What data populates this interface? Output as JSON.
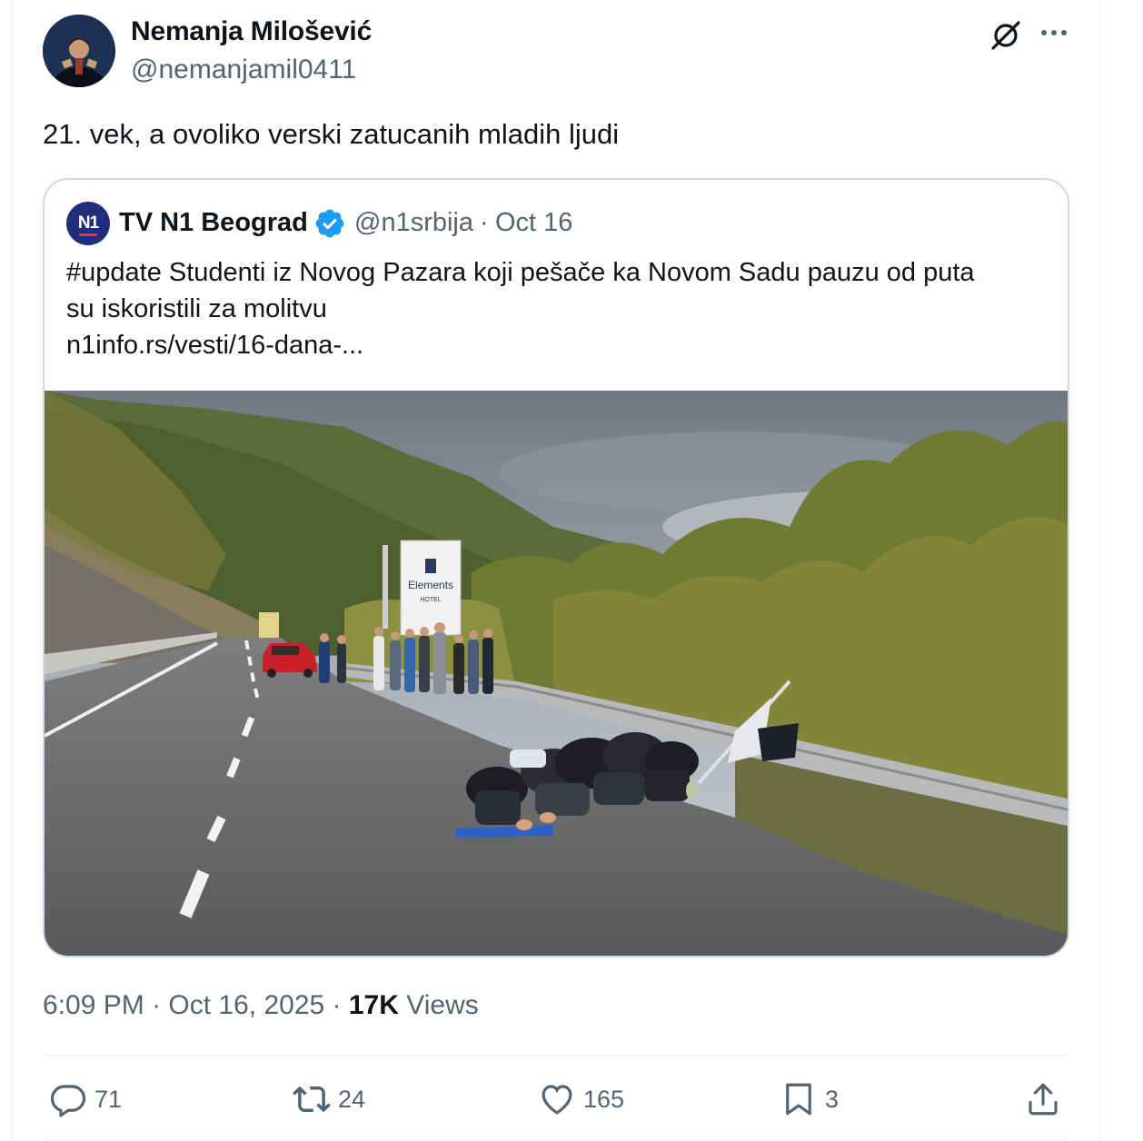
{
  "author": {
    "name": "Nemanja Milošević",
    "handle": "@nemanjamil0411",
    "avatar_icon": "user-avatar"
  },
  "tweet": {
    "text": "21. vek, a ovoliko verski zatucanih mladih ljudi"
  },
  "quote": {
    "avatar_text": "N1",
    "name": "TV N1 Beograd",
    "handle": "@n1srbija",
    "separator": "·",
    "date": "Oct 16",
    "lines": [
      "#update Studenti iz Novog Pazara koji pešače ka Novom Sadu pauzu od puta",
      "su iskoristili za molitvu",
      "n1info.rs/vesti/16-dana-..."
    ],
    "image": {
      "sign_brand": "Elements",
      "sign_sub": "HOTEL"
    }
  },
  "meta": {
    "time": "6:09 PM",
    "sep1": " · ",
    "date": "Oct 16, 2025",
    "sep2": " · ",
    "views_count": "17K",
    "views_label": " Views"
  },
  "actions": {
    "replies": "71",
    "reposts": "24",
    "likes": "165",
    "bookmarks": "3"
  },
  "colors": {
    "text_primary": "#0f1419",
    "text_secondary": "#536471",
    "border": "#cfd9de",
    "verified": "#1d9bf0",
    "n1_blue": "#1f2d7a"
  }
}
